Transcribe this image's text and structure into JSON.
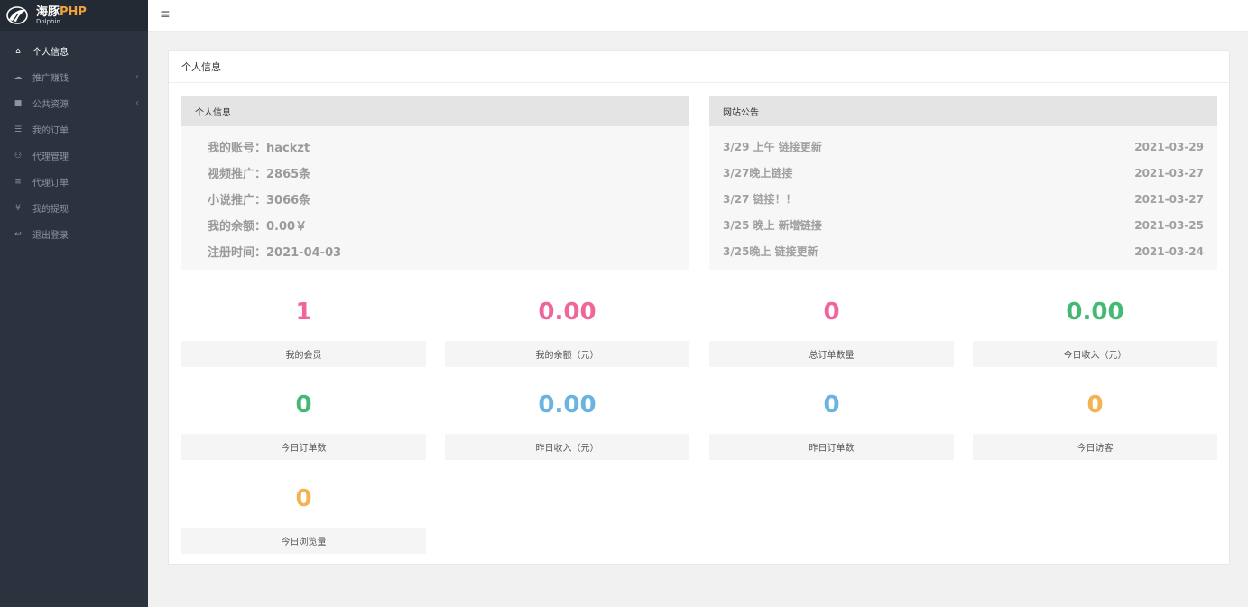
{
  "sidebar": {
    "logo": {
      "main": "海豚",
      "php": "PHP",
      "sub": "Dolphin"
    },
    "items": [
      {
        "label": "个人信息",
        "icon": "home-icon",
        "glyph": "⌂",
        "arrow": ""
      },
      {
        "label": "推广赚钱",
        "icon": "cloud-icon",
        "glyph": "☁",
        "arrow": "‹"
      },
      {
        "label": "公共资源",
        "icon": "video-camera-icon",
        "glyph": "■",
        "arrow": "‹"
      },
      {
        "label": "我的订单",
        "icon": "list-icon",
        "glyph": "☰",
        "arrow": ""
      },
      {
        "label": "代理管理",
        "icon": "users-icon",
        "glyph": "⚇",
        "arrow": ""
      },
      {
        "label": "代理订单",
        "icon": "bars-icon",
        "glyph": "≡",
        "arrow": ""
      },
      {
        "label": "我的提现",
        "icon": "yen-icon",
        "glyph": "¥",
        "arrow": ""
      },
      {
        "label": "退出登录",
        "icon": "reply-icon",
        "glyph": "↩",
        "arrow": ""
      }
    ]
  },
  "topbar": {
    "toggle": "≡"
  },
  "card": {
    "title": "个人信息",
    "info": {
      "title": "个人信息",
      "rows": [
        "我的账号：hackzt",
        "视频推广：2865条",
        "小说推广：3066条",
        "我的余额：0.00￥",
        "注册时间：2021-04-03"
      ]
    },
    "notices": {
      "title": "网站公告",
      "rows": [
        {
          "title": "3/29 上午 链接更新",
          "date": "2021-03-29"
        },
        {
          "title": "3/27晚上链接",
          "date": "2021-03-27"
        },
        {
          "title": "3/27 链接！！",
          "date": "2021-03-27"
        },
        {
          "title": "3/25 晚上 新增链接",
          "date": "2021-03-25"
        },
        {
          "title": "3/25晚上 链接更新",
          "date": "2021-03-24"
        }
      ]
    },
    "stats": [
      {
        "value": "1",
        "label": "我的会员",
        "color": "#f0669b"
      },
      {
        "value": "0.00",
        "label": "我的余额（元）",
        "color": "#f0669b"
      },
      {
        "value": "0",
        "label": "总订单数量",
        "color": "#f0669b"
      },
      {
        "value": "0.00",
        "label": "今日收入（元）",
        "color": "#44b874"
      },
      {
        "value": "0",
        "label": "今日订单数",
        "color": "#44b874"
      },
      {
        "value": "0.00",
        "label": "昨日收入（元）",
        "color": "#6ab4e1"
      },
      {
        "value": "0",
        "label": "昨日订单数",
        "color": "#6ab4e1"
      },
      {
        "value": "0",
        "label": "今日访客",
        "color": "#f2b352"
      },
      {
        "value": "0",
        "label": "今日浏览量",
        "color": "#f2b352"
      }
    ]
  }
}
